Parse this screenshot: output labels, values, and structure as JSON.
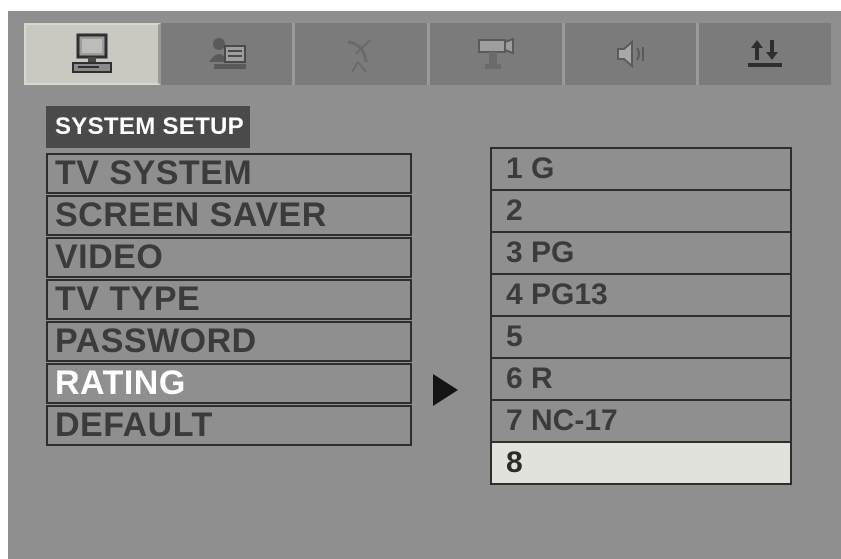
{
  "tabs": [
    {
      "icon": "monitor-icon",
      "active": true
    },
    {
      "icon": "user-icon",
      "active": false
    },
    {
      "icon": "dish-icon",
      "active": false
    },
    {
      "icon": "camera-icon",
      "active": false
    },
    {
      "icon": "speaker-icon",
      "active": false
    },
    {
      "icon": "arrows-icon",
      "active": false
    }
  ],
  "section_title": "SYSTEM SETUP",
  "menu": {
    "items": [
      {
        "label": "TV SYSTEM"
      },
      {
        "label": "SCREEN SAVER"
      },
      {
        "label": "VIDEO"
      },
      {
        "label": "TV TYPE"
      },
      {
        "label": "PASSWORD"
      },
      {
        "label": "RATING",
        "selected": true
      },
      {
        "label": "DEFAULT"
      }
    ]
  },
  "options": {
    "items": [
      {
        "label": "1 G"
      },
      {
        "label": "2"
      },
      {
        "label": "3 PG"
      },
      {
        "label": "4 PG13"
      },
      {
        "label": "5"
      },
      {
        "label": "6 R"
      },
      {
        "label": "7 NC-17"
      },
      {
        "label": "8",
        "highlighted": true
      }
    ]
  },
  "colors": {
    "background": "#8f8f8f",
    "title_bg": "#4a4a4a",
    "text": "#3b3b3b",
    "selected_text": "#ffffff",
    "highlight_bg": "#e2e2dd"
  }
}
